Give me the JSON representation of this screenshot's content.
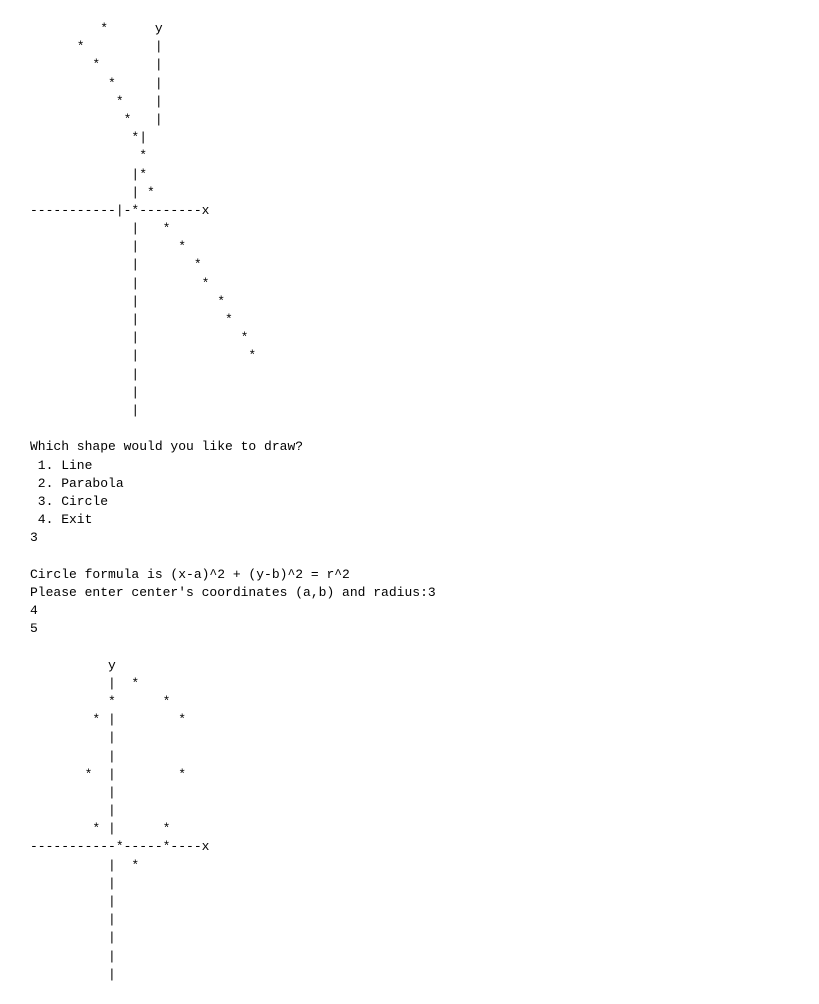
{
  "terminal": {
    "content_top": "         *      y\n      *         |\n        *       |\n          *     |\n           *    |\n            *   |\n             *| \n              *  \n             |*  \n             | *  \n-----------|-*--------x\n             |   *\n             |     *\n             |       *\n             |        *\n             |          *\n             |           *\n             |             *\n             |              *\n             |\n             |\n             |",
    "menu_prompt": "Which shape would you like to draw?",
    "menu_items": [
      "1. Line",
      "2. Parabola",
      "3. Circle",
      "4. Exit"
    ],
    "user_choice": "3",
    "circle_formula": "Circle formula is (x-a)^2 + (y-b)^2 = r^2",
    "circle_prompt": "Please enter center's coordinates (a,b) and radius:3",
    "input_a": "4",
    "input_b": "5",
    "content_bottom": "          y\n          |  *\n          *      *\n        * |        *\n          |\n          |\n       *  |        *\n          |\n          |\n        * |      *\n-----------*-----*----x\n          |  *\n          |\n          |\n          |\n          |\n          |\n          |"
  }
}
